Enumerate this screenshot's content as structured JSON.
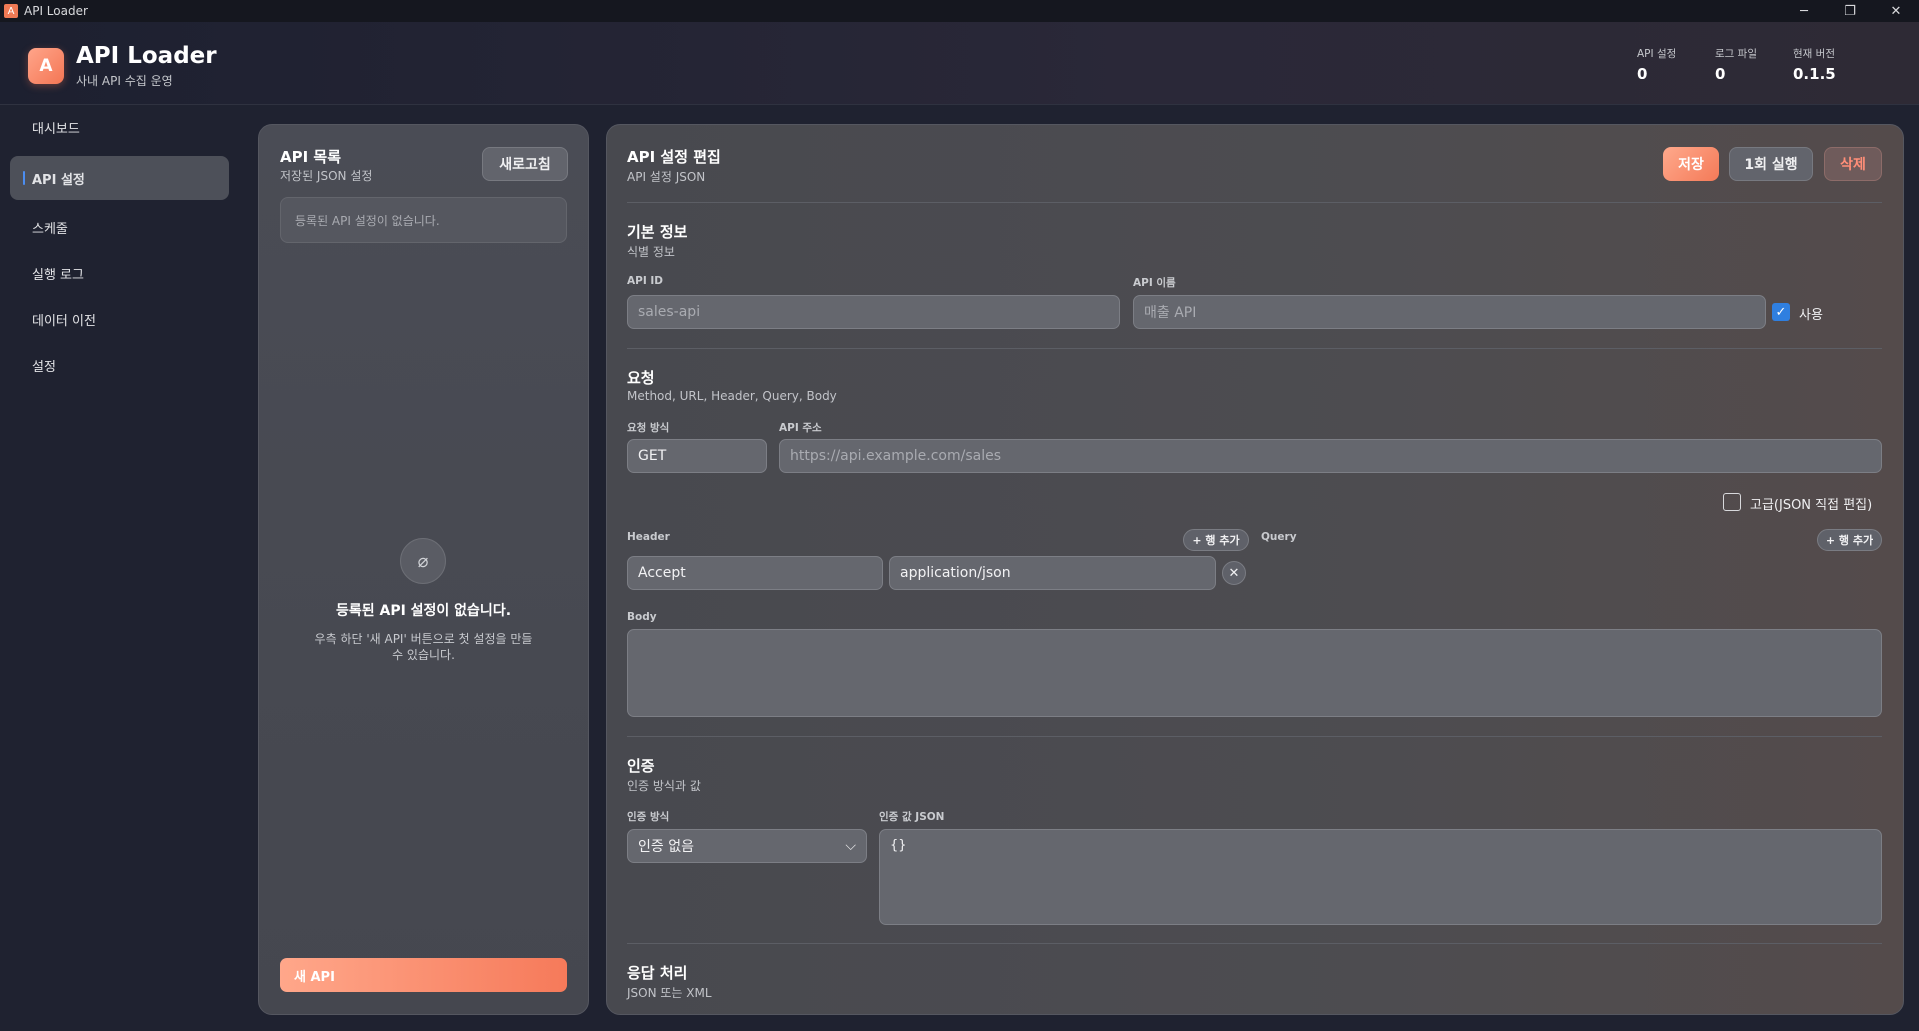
{
  "window": {
    "title": "API Loader",
    "app_icon_letter": "A",
    "minimize": "─",
    "restore": "❐",
    "close": "✕"
  },
  "header": {
    "logo_letter": "A",
    "title": "API Loader",
    "subtitle": "사내 API 수집 운영",
    "stats": [
      {
        "label": "API 설정",
        "value": "0"
      },
      {
        "label": "로그 파일",
        "value": "0"
      },
      {
        "label": "현재 버전",
        "value": "0.1.5"
      }
    ]
  },
  "sidebar": {
    "items": [
      {
        "label": "대시보드",
        "active": false
      },
      {
        "label": "API 설정",
        "active": true
      },
      {
        "label": "스케줄",
        "active": false
      },
      {
        "label": "실행 로그",
        "active": false
      },
      {
        "label": "데이터 이전",
        "active": false
      },
      {
        "label": "설정",
        "active": false
      }
    ]
  },
  "list_panel": {
    "title": "API 목록",
    "subtitle": "저장된 JSON 설정",
    "refresh_label": "새로고침",
    "empty_box_text": "등록된 API 설정이 없습니다.",
    "empty_icon": "⌀",
    "empty_title": "등록된 API 설정이 없습니다.",
    "empty_desc": "우측 하단 '새 API' 버튼으로 첫 설정을 만들 수 있습니다.",
    "new_api_label": "새 API"
  },
  "editor": {
    "title": "API 설정 편집",
    "subtitle": "API 설정 JSON",
    "save_label": "저장",
    "run_once_label": "1회 실행",
    "delete_label": "삭제",
    "basic": {
      "title": "기본 정보",
      "subtitle": "식별 정보",
      "api_id_label": "API ID",
      "api_id_placeholder": "sales-api",
      "api_name_label": "API 이름",
      "api_name_placeholder": "매출 API",
      "enabled_label": "사용",
      "enabled": true
    },
    "request": {
      "title": "요청",
      "subtitle": "Method, URL, Header, Query, Body",
      "method_label": "요청 방식",
      "method_value": "GET",
      "url_label": "API 주소",
      "url_placeholder": "https://api.example.com/sales",
      "advanced_label": "고급(JSON 직접 편집)",
      "advanced": false,
      "header_label": "Header",
      "header_add_label": "+ 행 추가",
      "query_label": "Query",
      "query_add_label": "+ 행 추가",
      "header_rows": [
        {
          "key": "Accept",
          "value": "application/json"
        }
      ],
      "body_label": "Body",
      "body_value": ""
    },
    "auth": {
      "title": "인증",
      "subtitle": "인증 방식과 값",
      "method_label": "인증 방식",
      "method_value": "인증 없음",
      "value_label": "인증 값 JSON",
      "value_json": "{}"
    },
    "response": {
      "title": "응답 처리",
      "subtitle": "JSON 또는 XML"
    }
  }
}
